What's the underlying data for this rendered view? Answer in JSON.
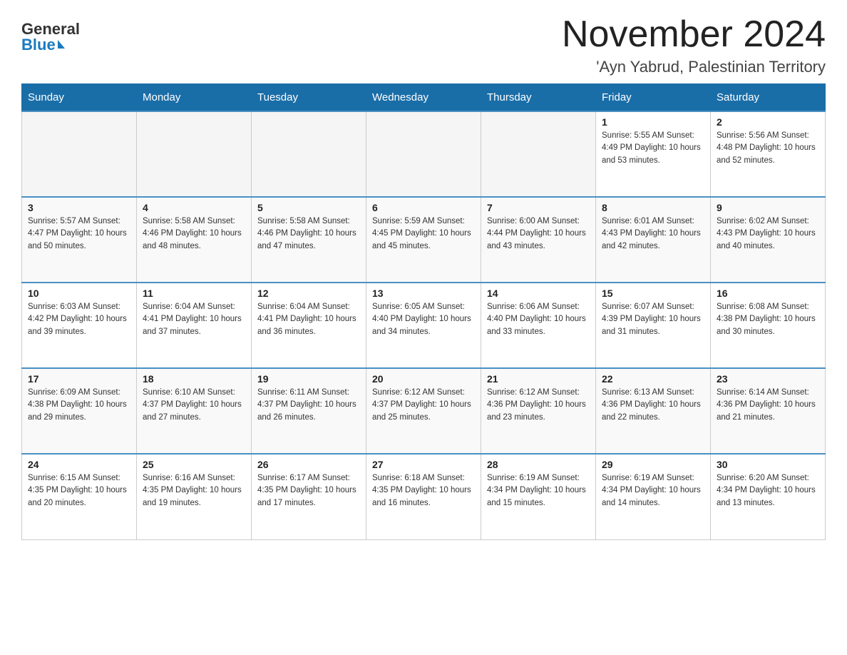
{
  "header": {
    "logo_general": "General",
    "logo_blue": "Blue",
    "month_title": "November 2024",
    "location": "'Ayn Yabrud, Palestinian Territory"
  },
  "days_of_week": [
    "Sunday",
    "Monday",
    "Tuesday",
    "Wednesday",
    "Thursday",
    "Friday",
    "Saturday"
  ],
  "weeks": [
    [
      {
        "day": "",
        "info": ""
      },
      {
        "day": "",
        "info": ""
      },
      {
        "day": "",
        "info": ""
      },
      {
        "day": "",
        "info": ""
      },
      {
        "day": "",
        "info": ""
      },
      {
        "day": "1",
        "info": "Sunrise: 5:55 AM\nSunset: 4:49 PM\nDaylight: 10 hours and 53 minutes."
      },
      {
        "day": "2",
        "info": "Sunrise: 5:56 AM\nSunset: 4:48 PM\nDaylight: 10 hours and 52 minutes."
      }
    ],
    [
      {
        "day": "3",
        "info": "Sunrise: 5:57 AM\nSunset: 4:47 PM\nDaylight: 10 hours and 50 minutes."
      },
      {
        "day": "4",
        "info": "Sunrise: 5:58 AM\nSunset: 4:46 PM\nDaylight: 10 hours and 48 minutes."
      },
      {
        "day": "5",
        "info": "Sunrise: 5:58 AM\nSunset: 4:46 PM\nDaylight: 10 hours and 47 minutes."
      },
      {
        "day": "6",
        "info": "Sunrise: 5:59 AM\nSunset: 4:45 PM\nDaylight: 10 hours and 45 minutes."
      },
      {
        "day": "7",
        "info": "Sunrise: 6:00 AM\nSunset: 4:44 PM\nDaylight: 10 hours and 43 minutes."
      },
      {
        "day": "8",
        "info": "Sunrise: 6:01 AM\nSunset: 4:43 PM\nDaylight: 10 hours and 42 minutes."
      },
      {
        "day": "9",
        "info": "Sunrise: 6:02 AM\nSunset: 4:43 PM\nDaylight: 10 hours and 40 minutes."
      }
    ],
    [
      {
        "day": "10",
        "info": "Sunrise: 6:03 AM\nSunset: 4:42 PM\nDaylight: 10 hours and 39 minutes."
      },
      {
        "day": "11",
        "info": "Sunrise: 6:04 AM\nSunset: 4:41 PM\nDaylight: 10 hours and 37 minutes."
      },
      {
        "day": "12",
        "info": "Sunrise: 6:04 AM\nSunset: 4:41 PM\nDaylight: 10 hours and 36 minutes."
      },
      {
        "day": "13",
        "info": "Sunrise: 6:05 AM\nSunset: 4:40 PM\nDaylight: 10 hours and 34 minutes."
      },
      {
        "day": "14",
        "info": "Sunrise: 6:06 AM\nSunset: 4:40 PM\nDaylight: 10 hours and 33 minutes."
      },
      {
        "day": "15",
        "info": "Sunrise: 6:07 AM\nSunset: 4:39 PM\nDaylight: 10 hours and 31 minutes."
      },
      {
        "day": "16",
        "info": "Sunrise: 6:08 AM\nSunset: 4:38 PM\nDaylight: 10 hours and 30 minutes."
      }
    ],
    [
      {
        "day": "17",
        "info": "Sunrise: 6:09 AM\nSunset: 4:38 PM\nDaylight: 10 hours and 29 minutes."
      },
      {
        "day": "18",
        "info": "Sunrise: 6:10 AM\nSunset: 4:37 PM\nDaylight: 10 hours and 27 minutes."
      },
      {
        "day": "19",
        "info": "Sunrise: 6:11 AM\nSunset: 4:37 PM\nDaylight: 10 hours and 26 minutes."
      },
      {
        "day": "20",
        "info": "Sunrise: 6:12 AM\nSunset: 4:37 PM\nDaylight: 10 hours and 25 minutes."
      },
      {
        "day": "21",
        "info": "Sunrise: 6:12 AM\nSunset: 4:36 PM\nDaylight: 10 hours and 23 minutes."
      },
      {
        "day": "22",
        "info": "Sunrise: 6:13 AM\nSunset: 4:36 PM\nDaylight: 10 hours and 22 minutes."
      },
      {
        "day": "23",
        "info": "Sunrise: 6:14 AM\nSunset: 4:36 PM\nDaylight: 10 hours and 21 minutes."
      }
    ],
    [
      {
        "day": "24",
        "info": "Sunrise: 6:15 AM\nSunset: 4:35 PM\nDaylight: 10 hours and 20 minutes."
      },
      {
        "day": "25",
        "info": "Sunrise: 6:16 AM\nSunset: 4:35 PM\nDaylight: 10 hours and 19 minutes."
      },
      {
        "day": "26",
        "info": "Sunrise: 6:17 AM\nSunset: 4:35 PM\nDaylight: 10 hours and 17 minutes."
      },
      {
        "day": "27",
        "info": "Sunrise: 6:18 AM\nSunset: 4:35 PM\nDaylight: 10 hours and 16 minutes."
      },
      {
        "day": "28",
        "info": "Sunrise: 6:19 AM\nSunset: 4:34 PM\nDaylight: 10 hours and 15 minutes."
      },
      {
        "day": "29",
        "info": "Sunrise: 6:19 AM\nSunset: 4:34 PM\nDaylight: 10 hours and 14 minutes."
      },
      {
        "day": "30",
        "info": "Sunrise: 6:20 AM\nSunset: 4:34 PM\nDaylight: 10 hours and 13 minutes."
      }
    ]
  ]
}
